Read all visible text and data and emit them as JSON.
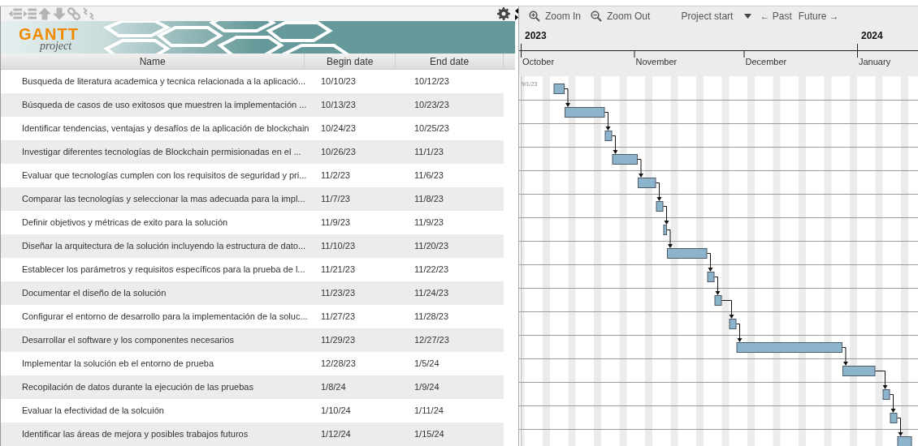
{
  "toolbar": [
    {
      "kind": "outdent",
      "disabled": true
    },
    {
      "kind": "indent",
      "disabled": true
    },
    {
      "kind": "up",
      "disabled": true
    },
    {
      "kind": "down",
      "disabled": true
    },
    {
      "kind": "link",
      "disabled": true
    },
    {
      "kind": "unlink",
      "disabled": true
    }
  ],
  "logo": {
    "title": "GANTT",
    "subtitle": "project"
  },
  "table": {
    "columns": [
      "Name",
      "Begin date",
      "End date"
    ],
    "rows": [
      {
        "name": "Busqueda de literatura academica y tecnica relacionada a la aplicació...",
        "begin": "10/10/23",
        "end": "10/12/23"
      },
      {
        "name": "Búsqueda de casos de uso exitosos que muestren la implementación ...",
        "begin": "10/13/23",
        "end": "10/23/23"
      },
      {
        "name": "Identificar tendencias, ventajas y desafíos de la aplicación de blockchain",
        "begin": "10/24/23",
        "end": "10/25/23"
      },
      {
        "name": "Investigar diferentes tecnologías de Blockchain permisionadas en el ...",
        "begin": "10/26/23",
        "end": "11/1/23"
      },
      {
        "name": "Evaluar que tecnologías cumplen con los requisitos de seguridad y pri...",
        "begin": "11/2/23",
        "end": "11/6/23"
      },
      {
        "name": "Comparar las tecnologías y seleccionar la mas adecuada para la impl...",
        "begin": "11/7/23",
        "end": "11/8/23"
      },
      {
        "name": "Definir objetivos y métricas de exito para la solución",
        "begin": "11/9/23",
        "end": "11/9/23"
      },
      {
        "name": "Diseñar la arquitectura de la solución incluyendo la estructura de dato...",
        "begin": "11/10/23",
        "end": "11/20/23"
      },
      {
        "name": "Establecer los parámetros y requisitos específicos para la prueba de l...",
        "begin": "11/21/23",
        "end": "11/22/23"
      },
      {
        "name": "Documentar el diseño de la solución",
        "begin": "11/23/23",
        "end": "11/24/23"
      },
      {
        "name": "Configurar el entorno de desarrollo para la implementación de la soluc...",
        "begin": "11/27/23",
        "end": "11/28/23"
      },
      {
        "name": "Desarrollar el software y los componentes necesarios",
        "begin": "11/29/23",
        "end": "12/27/23"
      },
      {
        "name": "Implementar la solución eb el entorno de prueba",
        "begin": "12/28/23",
        "end": "1/5/24"
      },
      {
        "name": "Recopilación de datos durante la ejecución de las pruebas",
        "begin": "1/8/24",
        "end": "1/9/24"
      },
      {
        "name": "Evaluar la efectividad de la solcuión",
        "begin": "1/10/24",
        "end": "1/11/24"
      },
      {
        "name": "Identificar las áreas de mejora y posibles trabajos futuros",
        "begin": "1/12/24",
        "end": "1/15/24"
      }
    ]
  },
  "chart_toolbar": {
    "zoom_in": "Zoom In",
    "zoom_out": "Zoom Out",
    "project_start": "Project start",
    "past": "← Past",
    "future": "Future →"
  },
  "timeline": {
    "years": [
      "2023",
      "2024"
    ],
    "months": [
      "October",
      "November",
      "December",
      "January"
    ],
    "start_label": "9/1/23"
  }
}
